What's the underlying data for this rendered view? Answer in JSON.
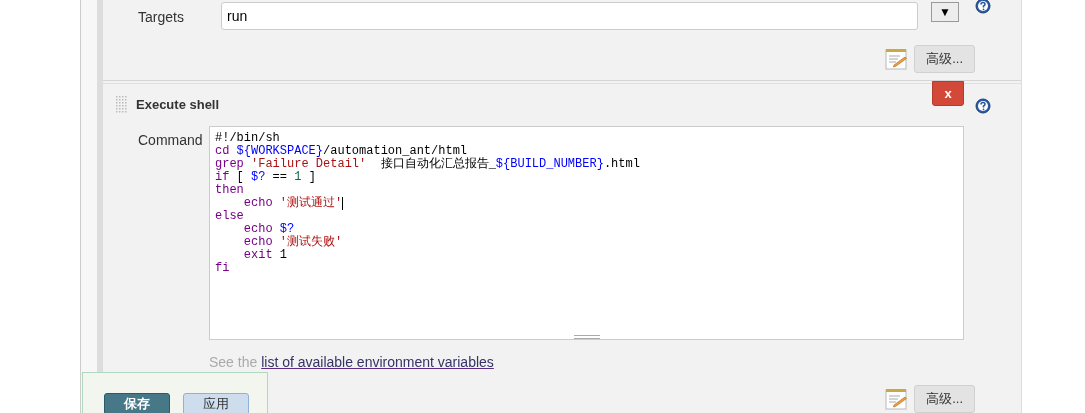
{
  "ant_build": {
    "targets_label": "Targets",
    "targets_value": "run",
    "dropdown_glyph": "▼",
    "advanced_button": "高级..."
  },
  "execute_shell": {
    "title": "Execute shell",
    "delete_button": "x",
    "command_label": "Command",
    "code_lines": [
      [
        {
          "kind": "plain",
          "text": "#!/bin/sh"
        }
      ],
      [
        {
          "kind": "keyword",
          "text": "cd "
        },
        {
          "kind": "variable",
          "text": "${WORKSPACE}"
        },
        {
          "kind": "plain",
          "text": "/automation_ant/html"
        }
      ],
      [
        {
          "kind": "keyword",
          "text": "grep "
        },
        {
          "kind": "string",
          "text": "'Failure Detail'"
        },
        {
          "kind": "plain",
          "text": "  接口自动化汇总报告_"
        },
        {
          "kind": "variable",
          "text": "${BUILD_NUMBER}"
        },
        {
          "kind": "plain",
          "text": ".html"
        }
      ],
      [
        {
          "kind": "keyword",
          "text": "if "
        },
        {
          "kind": "plain",
          "text": "[ "
        },
        {
          "kind": "variable",
          "text": "$?"
        },
        {
          "kind": "plain",
          "text": " == "
        },
        {
          "kind": "number",
          "text": "1"
        },
        {
          "kind": "plain",
          "text": " ]"
        }
      ],
      [
        {
          "kind": "keyword",
          "text": "then"
        }
      ],
      [
        {
          "kind": "keyword",
          "text": "    echo "
        },
        {
          "kind": "string",
          "text": "'测试通过'"
        },
        {
          "kind": "cursor"
        }
      ],
      [
        {
          "kind": "keyword",
          "text": "else"
        }
      ],
      [
        {
          "kind": "keyword",
          "text": "    echo "
        },
        {
          "kind": "variable",
          "text": "$?"
        }
      ],
      [
        {
          "kind": "keyword",
          "text": "    echo "
        },
        {
          "kind": "string",
          "text": "'测试失败'"
        }
      ],
      [
        {
          "kind": "keyword",
          "text": "    exit "
        },
        {
          "kind": "plain",
          "text": "1"
        }
      ],
      [
        {
          "kind": "keyword",
          "text": "fi"
        }
      ]
    ],
    "hint_prefix": "See the",
    "hint_link": "list of available environment variables",
    "advanced_button": "高级..."
  },
  "footer_buttons": [
    {
      "label": "保存",
      "kind": "primary"
    },
    {
      "label": "应用",
      "kind": "secondary"
    }
  ]
}
